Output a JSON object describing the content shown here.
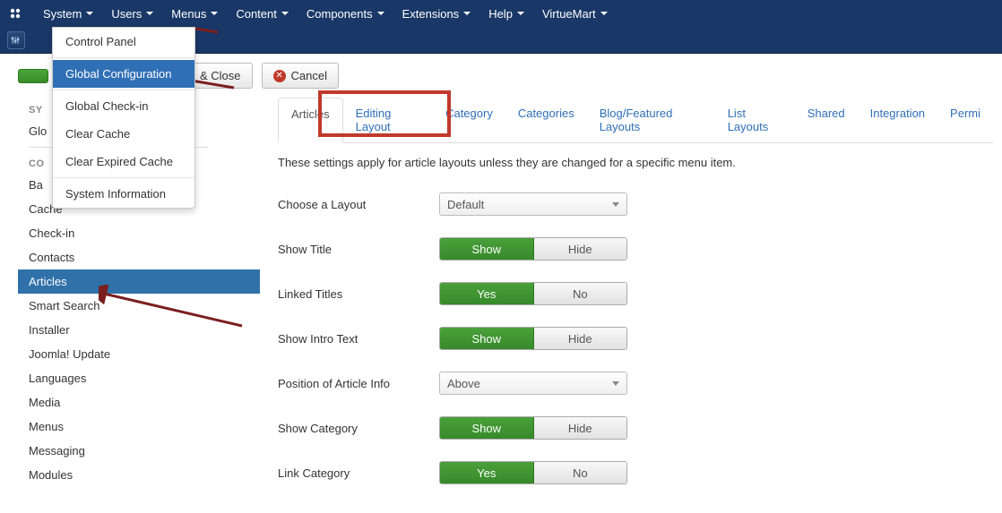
{
  "topmenu": [
    "System",
    "Users",
    "Menus",
    "Content",
    "Components",
    "Extensions",
    "Help",
    "VirtueMart"
  ],
  "dropdown": {
    "items": [
      "Control Panel",
      "Global Configuration",
      "Global Check-in",
      "Clear Cache",
      "Clear Expired Cache",
      "System Information"
    ],
    "active_index": 1
  },
  "toolbar": {
    "save_close": "& Close",
    "cancel": "Cancel"
  },
  "sidebar": {
    "group1_head": "SY",
    "group1_items": [
      "Glo"
    ],
    "group2_head": "CO",
    "group2_items": [
      "Ba",
      "Cache",
      "Check-in",
      "Contacts",
      "Articles",
      "Smart Search",
      "Installer",
      "Joomla! Update",
      "Languages",
      "Media",
      "Menus",
      "Messaging",
      "Modules"
    ],
    "active": "Articles"
  },
  "tabs": [
    "Articles",
    "Editing Layout",
    "Category",
    "Categories",
    "Blog/Featured Layouts",
    "List Layouts",
    "Shared",
    "Integration",
    "Permi"
  ],
  "active_tab": 0,
  "description": "These settings apply for article layouts unless they are changed for a specific menu item.",
  "fields": [
    {
      "label": "Choose a Layout",
      "type": "select",
      "value": "Default"
    },
    {
      "label": "Show Title",
      "type": "toggle",
      "on": "Show",
      "off": "Hide",
      "value": "on"
    },
    {
      "label": "Linked Titles",
      "type": "toggle",
      "on": "Yes",
      "off": "No",
      "value": "on"
    },
    {
      "label": "Show Intro Text",
      "type": "toggle",
      "on": "Show",
      "off": "Hide",
      "value": "on"
    },
    {
      "label": "Position of Article Info",
      "type": "select",
      "value": "Above"
    },
    {
      "label": "Show Category",
      "type": "toggle",
      "on": "Show",
      "off": "Hide",
      "value": "on"
    },
    {
      "label": "Link Category",
      "type": "toggle",
      "on": "Yes",
      "off": "No",
      "value": "on"
    }
  ]
}
